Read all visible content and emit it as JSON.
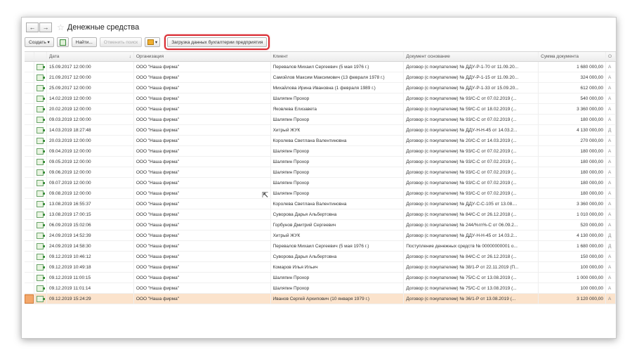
{
  "window": {
    "back_label": "←",
    "forward_label": "→",
    "star_label": "☆",
    "title": "Денежные средства"
  },
  "toolbar": {
    "create_label": "Создать ▾",
    "find_label": "Найти...",
    "cancel_search_label": "Отменить поиск",
    "load_label": "Загрузка данных бухгалтерии предприятия"
  },
  "columns": {
    "date": "Дата",
    "sort_indicator": "↓",
    "org": "Организация",
    "client": "Клиент",
    "doc": "Документ основание",
    "sum": "Сумма документа",
    "extra": "О"
  },
  "rows": [
    {
      "date": "15.09.2017 12:00:00",
      "org": "ООО \"Наша фирма\"",
      "client": "Перевалов Михаил Сергеевич (5 мая 1976 г.)",
      "doc": "Договор (с покупателем) № ДДУ-Р-1-70 от 11.09.20...",
      "sum": "1 680 000,00",
      "x": "А"
    },
    {
      "date": "21.09.2017 12:00:00",
      "org": "ООО \"Наша фирма\"",
      "client": "Самойлов Максим Максимович (13 февраля 1978 г.)",
      "doc": "Договор (с покупателем) № ДДУ-Р-1-15 от 11.09.20...",
      "sum": "324 000,00",
      "x": "А"
    },
    {
      "date": "25.09.2017 12:00:00",
      "org": "ООО \"Наша фирма\"",
      "client": "Михайлова Ирина Ивановна (1 февраля 1989 г.)",
      "doc": "Договор (с покупателем) № ДДУ-Р-1-33 от 15.09.20...",
      "sum": "612 000,00",
      "x": "А"
    },
    {
      "date": "14.02.2019 12:00:00",
      "org": "ООО \"Наша фирма\"",
      "client": "Шаляпин Прохор",
      "doc": "Договор (с покупателем) № 93/С-С от 07.02.2019 (...",
      "sum": "540 000,00",
      "x": "А"
    },
    {
      "date": "20.02.2019 12:00:00",
      "org": "ООО \"Наша фирма\"",
      "client": "Яковлева Елизавета",
      "doc": "Договор (с покупателем) № 59/С-С от 18.02.2019 (...",
      "sum": "3 360 000,00",
      "x": "А"
    },
    {
      "date": "09.03.2019 12:00:00",
      "org": "ООО \"Наша фирма\"",
      "client": "Шаляпин Прохор",
      "doc": "Договор (с покупателем) № 93/С-С от 07.02.2019 (...",
      "sum": "180 000,00",
      "x": "А"
    },
    {
      "date": "14.03.2019 18:27:48",
      "org": "ООО \"Наша фирма\"",
      "client": "Хитрый ЖУК",
      "doc": "Договор (с покупателем) № ДДУ-Н-Н-45 от 14.03.2...",
      "sum": "4 130 000,00",
      "x": "Д"
    },
    {
      "date": "20.03.2019 12:00:00",
      "org": "ООО \"Наша фирма\"",
      "client": "Королева Светлана Валентиновна",
      "doc": "Договор (с покупателем) № 20/С-С от 14.03.2019 (...",
      "sum": "270 000,00",
      "x": "А"
    },
    {
      "date": "09.04.2019 12:00:00",
      "org": "ООО \"Наша фирма\"",
      "client": "Шаляпин Прохор",
      "doc": "Договор (с покупателем) № 93/С-С от 07.02.2019 (...",
      "sum": "180 000,00",
      "x": "А"
    },
    {
      "date": "09.05.2019 12:00:00",
      "org": "ООО \"Наша фирма\"",
      "client": "Шаляпин Прохор",
      "doc": "Договор (с покупателем) № 93/С-С от 07.02.2019 (...",
      "sum": "180 000,00",
      "x": "А"
    },
    {
      "date": "09.06.2019 12:00:00",
      "org": "ООО \"Наша фирма\"",
      "client": "Шаляпин Прохор",
      "doc": "Договор (с покупателем) № 93/С-С от 07.02.2019 (...",
      "sum": "180 000,00",
      "x": "А"
    },
    {
      "date": "09.07.2019 12:00:00",
      "org": "ООО \"Наша фирма\"",
      "client": "Шаляпин Прохор",
      "doc": "Договор (с покупателем) № 93/С-С от 07.02.2019 (...",
      "sum": "180 000,00",
      "x": "А"
    },
    {
      "date": "09.08.2019 12:00:00",
      "org": "ООО \"Наша фирма\"",
      "client": "Шаляпин Прохор",
      "doc": "Договор (с покупателем) № 93/С-С от 07.02.2019 (...",
      "sum": "180 000,00",
      "x": "А"
    },
    {
      "date": "13.08.2019 16:55:37",
      "org": "ООО \"Наша фирма\"",
      "client": "Королева Светлана Валентиновна",
      "doc": "Договор (с покупателем) № ДДУ-С-С-105 от 13.08....",
      "sum": "3 360 000,00",
      "x": "А"
    },
    {
      "date": "13.08.2019 17:00:15",
      "org": "ООО \"Наша фирма\"",
      "client": "Суворова Дарья Альбертовна",
      "doc": "Договор (с покупателем) № 84/С-С от 26.12.2018 (...",
      "sum": "1 010 000,00",
      "x": "А"
    },
    {
      "date": "06.09.2019 15:02:06",
      "org": "ООО \"Наша фирма\"",
      "client": "Горбунов Дмитрий Сергеевич",
      "doc": "Договор (с покупателем) № 244/%гп%-С от 06.09.2...",
      "sum": "520 000,00",
      "x": "А"
    },
    {
      "date": "24.09.2019 14:52:39",
      "org": "ООО \"Наша фирма\"",
      "client": "Хитрый ЖУК",
      "doc": "Договор (с покупателем) № ДДУ-Н-Н-45 от 14.03.2...",
      "sum": "4 130 000,00",
      "x": "Д"
    },
    {
      "date": "24.09.2019 14:58:30",
      "org": "ООО \"Наша фирма\"",
      "client": "Перевалов Михаил Сергеевич (5 мая 1976 г.)",
      "doc": "Поступление денежных средств № 00000000001 о...",
      "sum": "1 680 000,00",
      "x": "Д"
    },
    {
      "date": "09.12.2019 10:46:12",
      "org": "ООО \"Наша фирма\"",
      "client": "Суворова Дарья Альбертовна",
      "doc": "Договор (с покупателем) № 84/С-С от 26.12.2018 (...",
      "sum": "150 000,00",
      "x": "А"
    },
    {
      "date": "09.12.2019 10:49:18",
      "org": "ООО \"Наша фирма\"",
      "client": "Комаров Илья Ильич",
      "doc": "Договор (с покупателем) № 38/1-Р от 22.11.2019 (П...",
      "sum": "100 000,00",
      "x": "А"
    },
    {
      "date": "09.12.2019 11:00:15",
      "org": "ООО \"Наша фирма\"",
      "client": "Шаляпин Прохор",
      "doc": "Договор (с покупателем) № 75/С-С от 13.08.2019 (...",
      "sum": "1 000 000,00",
      "x": "А"
    },
    {
      "date": "09.12.2019 11:01:14",
      "org": "ООО \"Наша фирма\"",
      "client": "Шаляпин Прохор",
      "doc": "Договор (с покупателем) № 75/С-С от 13.08.2019 (...",
      "sum": "100 000,00",
      "x": "А"
    },
    {
      "date": "09.12.2019 15:24:29",
      "org": "ООО \"Наша фирма\"",
      "client": "Иванов Сергей Архипович (10 января 1979 г.)",
      "doc": "Договор (с покупателем) № 36/1-Р от 13.08.2019 (...",
      "sum": "3 120 000,00",
      "x": "А",
      "selected": true
    }
  ],
  "colors": {
    "selection_row": "#fbe3cc",
    "highlight_border": "#d9272e"
  }
}
